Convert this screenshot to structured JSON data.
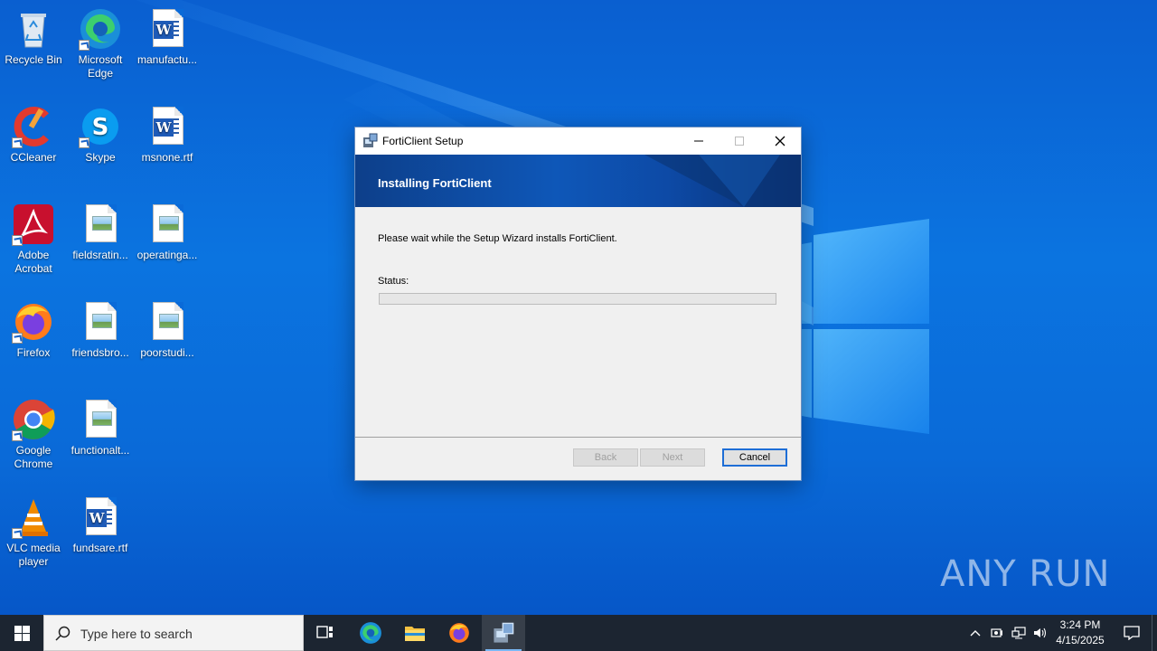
{
  "desktop": {
    "icons": [
      {
        "label": "Recycle Bin",
        "icon": "recycle-bin-icon"
      },
      {
        "label": "Microsoft Edge",
        "icon": "edge-icon"
      },
      {
        "label": "manufactu...",
        "icon": "word-doc-icon"
      },
      {
        "label": "CCleaner",
        "icon": "ccleaner-icon"
      },
      {
        "label": "Skype",
        "icon": "skype-icon"
      },
      {
        "label": "msnone.rtf",
        "icon": "word-doc-icon"
      },
      {
        "label": "Adobe Acrobat",
        "icon": "acrobat-icon"
      },
      {
        "label": "fieldsratin...",
        "icon": "image-file-icon"
      },
      {
        "label": "operatinga...",
        "icon": "image-file-icon"
      },
      {
        "label": "Firefox",
        "icon": "firefox-icon"
      },
      {
        "label": "friendsbro...",
        "icon": "image-file-icon"
      },
      {
        "label": "poorstudi...",
        "icon": "image-file-icon"
      },
      {
        "label": "Google Chrome",
        "icon": "chrome-icon"
      },
      {
        "label": "functionalt...",
        "icon": "image-file-icon"
      },
      {
        "label": "VLC media player",
        "icon": "vlc-icon"
      },
      {
        "label": "fundsare.rtf",
        "icon": "word-doc-icon"
      }
    ]
  },
  "window": {
    "title": "FortiClient Setup",
    "banner_title": "Installing FortiClient",
    "message": "Please wait while the Setup Wizard installs FortiClient.",
    "status_label": "Status:",
    "progress_fraction": 0,
    "buttons": {
      "back": "Back",
      "next": "Next",
      "cancel": "Cancel"
    },
    "controls": {
      "minimize": "minimize-icon",
      "maximize": "maximize-icon",
      "close": "close-icon"
    }
  },
  "watermark": "ANY RUN",
  "taskbar": {
    "search_placeholder": "Type here to search",
    "pinned": [
      "task-view-icon",
      "edge-icon",
      "file-explorer-icon",
      "firefox-icon",
      "installer-icon"
    ],
    "time": "3:24 PM",
    "date": "4/15/2025"
  },
  "colors": {
    "desktop_blue": "#0b74e0",
    "taskbar": "#1c2531",
    "banner": "#0e57b8",
    "cancel_focus": "#1e6ed6"
  }
}
